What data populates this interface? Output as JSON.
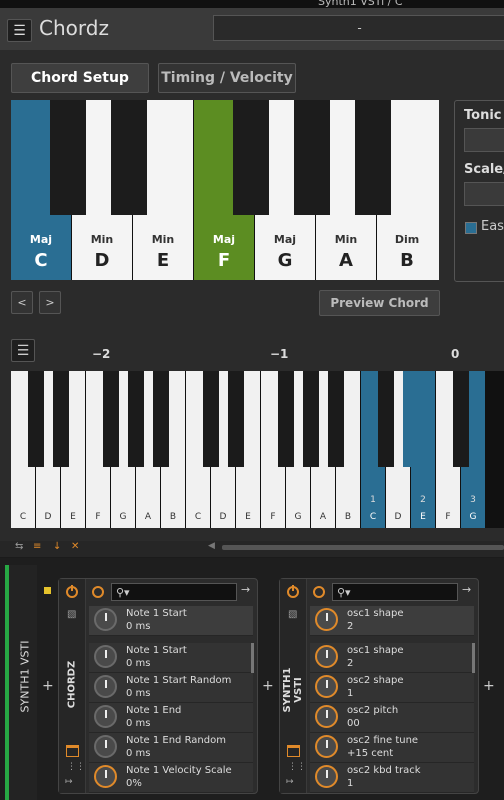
{
  "window_title": "Synth1 VSTi / C",
  "app": {
    "title": "Chordz",
    "preset": "-"
  },
  "tabs": [
    {
      "label": "Chord Setup"
    },
    {
      "label": "Timing / Velocity"
    }
  ],
  "chord_keys": [
    {
      "quality": "Maj",
      "note": "C",
      "state": "selected-blue"
    },
    {
      "quality": "Min",
      "note": "D",
      "state": "normal"
    },
    {
      "quality": "Min",
      "note": "E",
      "state": "normal"
    },
    {
      "quality": "Maj",
      "note": "F",
      "state": "selected-green"
    },
    {
      "quality": "Maj",
      "note": "G",
      "state": "normal"
    },
    {
      "quality": "Min",
      "note": "A",
      "state": "normal"
    },
    {
      "quality": "Dim",
      "note": "B",
      "state": "normal"
    }
  ],
  "right_panel": {
    "tonic_label": "Tonic",
    "scale_label": "Scale/C",
    "easy_label": "Easy"
  },
  "nav": {
    "prev": "<",
    "next": ">",
    "preview": "Preview Chord"
  },
  "octave_labels": [
    "−2",
    "−1",
    "0"
  ],
  "piano_keys": [
    {
      "label": "C",
      "num": "",
      "hi": false
    },
    {
      "label": "D",
      "num": "",
      "hi": false
    },
    {
      "label": "E",
      "num": "",
      "hi": false
    },
    {
      "label": "F",
      "num": "",
      "hi": false
    },
    {
      "label": "G",
      "num": "",
      "hi": false
    },
    {
      "label": "A",
      "num": "",
      "hi": false
    },
    {
      "label": "B",
      "num": "",
      "hi": false
    },
    {
      "label": "C",
      "num": "",
      "hi": false
    },
    {
      "label": "D",
      "num": "",
      "hi": false
    },
    {
      "label": "E",
      "num": "",
      "hi": false
    },
    {
      "label": "F",
      "num": "",
      "hi": false
    },
    {
      "label": "G",
      "num": "",
      "hi": false
    },
    {
      "label": "A",
      "num": "",
      "hi": false
    },
    {
      "label": "B",
      "num": "",
      "hi": false
    },
    {
      "label": "C",
      "num": "1",
      "hi": true
    },
    {
      "label": "D",
      "num": "",
      "hi": false
    },
    {
      "label": "E",
      "num": "2",
      "hi": true
    },
    {
      "label": "F",
      "num": "",
      "hi": false
    },
    {
      "label": "G",
      "num": "3",
      "hi": true
    }
  ],
  "track": {
    "name": "SYNTH1 VSTI"
  },
  "devices": [
    {
      "name": "CHORDZ",
      "params": [
        {
          "name": "Note 1 Start",
          "value": "0 ms",
          "on": false
        },
        {
          "name": "Note 1 Start",
          "value": "0 ms",
          "on": false
        },
        {
          "name": "Note 1 Start Random",
          "value": "0 ms",
          "on": false
        },
        {
          "name": "Note 1 End",
          "value": "0 ms",
          "on": false
        },
        {
          "name": "Note 1 End Random",
          "value": "0 ms",
          "on": false
        },
        {
          "name": "Note 1 Velocity Scale",
          "value": "0%",
          "on": true
        }
      ]
    },
    {
      "name": "SYNTH1 VSTI",
      "params": [
        {
          "name": "osc1 shape",
          "value": "2",
          "on": true
        },
        {
          "name": "osc1 shape",
          "value": "2",
          "on": true
        },
        {
          "name": "osc2 shape",
          "value": "1",
          "on": true
        },
        {
          "name": "osc2 pitch",
          "value": "00",
          "on": true
        },
        {
          "name": "osc2 fine tune",
          "value": "+15 cent",
          "on": true
        },
        {
          "name": "osc2 kbd track",
          "value": "1",
          "on": true
        }
      ]
    }
  ]
}
